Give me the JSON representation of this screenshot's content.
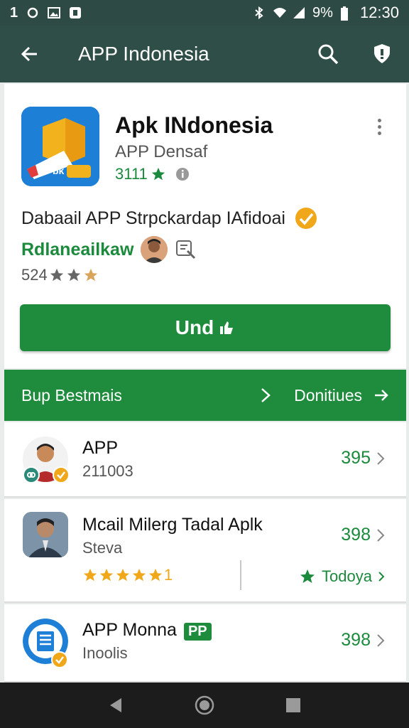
{
  "status_bar": {
    "left_text": "1",
    "battery": "9%",
    "time": "12:30"
  },
  "app_bar": {
    "title": "APP Indonesia"
  },
  "app": {
    "title": "Apk INdonesia",
    "developer": "APP Densaf",
    "rating_value": "3111",
    "description": "Dabaail APP Strpckardap IAfidoai",
    "editor_label": "Rdlaneailkaw",
    "review_count": "524",
    "install_label": "Und",
    "icon_badge": "bk"
  },
  "section": {
    "title": "Bup Bestmais",
    "link_label": "Donitiues"
  },
  "list": [
    {
      "title": "APP",
      "subtitle": "211003",
      "price": "395"
    },
    {
      "title": "Mcail Milerg Tadal Aplk",
      "subtitle": "Steva",
      "price": "398",
      "rating_suffix": "1",
      "today_label": "Todoya"
    },
    {
      "title": "APP Monna",
      "tag": "PP",
      "subtitle": "Inoolis",
      "price": "398"
    }
  ],
  "colors": {
    "app_bar": "#2f4e48",
    "status_bar": "#2e4a44",
    "primary_green": "#1f8c3d",
    "star_gold": "#f0a81a"
  }
}
